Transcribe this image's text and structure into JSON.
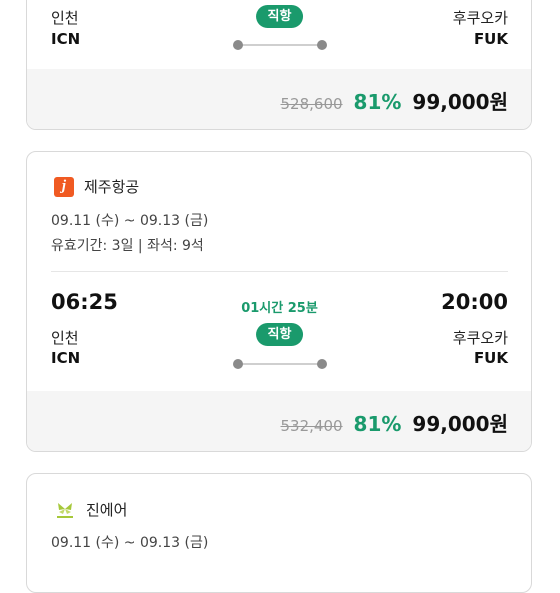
{
  "cards": [
    {
      "route": {
        "origin_city": "인천",
        "origin_code": "ICN",
        "dest_city": "후쿠오카",
        "dest_code": "FUK",
        "badge": "직항"
      },
      "price": {
        "original": "528,600",
        "discount": "81%",
        "final": "99,000원"
      }
    },
    {
      "airline": {
        "name": "제주항공",
        "logo_icon": "jeju-air-logo-icon",
        "logo_letter": "j"
      },
      "dates": "09.11 (수) ~ 09.13 (금)",
      "meta": "유효기간: 3일 | 좌석: 9석",
      "route": {
        "departure_time": "06:25",
        "arrival_time": "20:00",
        "duration": "01시간 25분",
        "origin_city": "인천",
        "origin_code": "ICN",
        "dest_city": "후쿠오카",
        "dest_code": "FUK",
        "badge": "직항"
      },
      "price": {
        "original": "532,400",
        "discount": "81%",
        "final": "99,000원"
      }
    },
    {
      "airline": {
        "name": "진에어",
        "logo_icon": "jin-air-logo-icon"
      },
      "dates": "09.11 (수) ~ 09.13 (금)"
    }
  ],
  "colors": {
    "accent": "#1a9a6c",
    "jeju_brand": "#f05a22",
    "jin_brand": "#a6c83a"
  }
}
